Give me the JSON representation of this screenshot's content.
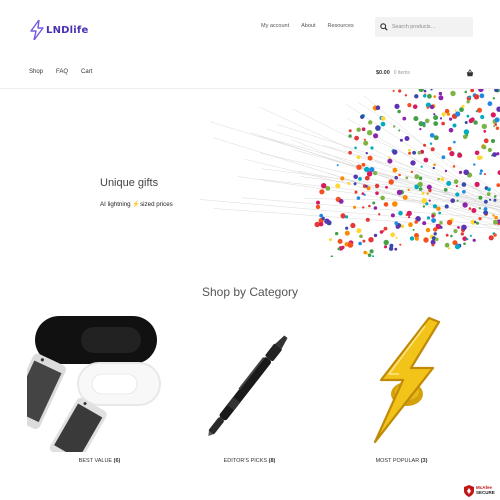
{
  "brand": {
    "name": "LNDlife",
    "color": "#4b2fb4"
  },
  "top_links": [
    "My account",
    "About",
    "Resources"
  ],
  "search": {
    "placeholder": "Search products…"
  },
  "nav": [
    "Shop",
    "FAQ",
    "Cart"
  ],
  "cart": {
    "amount": "$0.00",
    "items": "0 items"
  },
  "hero": {
    "title": "Unique gifts",
    "subtitle_pre": "AI lightning ",
    "subtitle_emoji": "⚡",
    "subtitle_post": "sized prices"
  },
  "categories_title": "Shop by Category",
  "categories": [
    {
      "label": "BEST VALUE",
      "count": "(6)"
    },
    {
      "label": "EDITOR'S PICKS",
      "count": "(8)"
    },
    {
      "label": "MOST POPULAR",
      "count": "(3)"
    }
  ],
  "badge": {
    "line1": "McAfee",
    "line2": "SECURE"
  },
  "colors": {
    "accent": "#4b2fb4",
    "bolt": "#f2c318"
  }
}
